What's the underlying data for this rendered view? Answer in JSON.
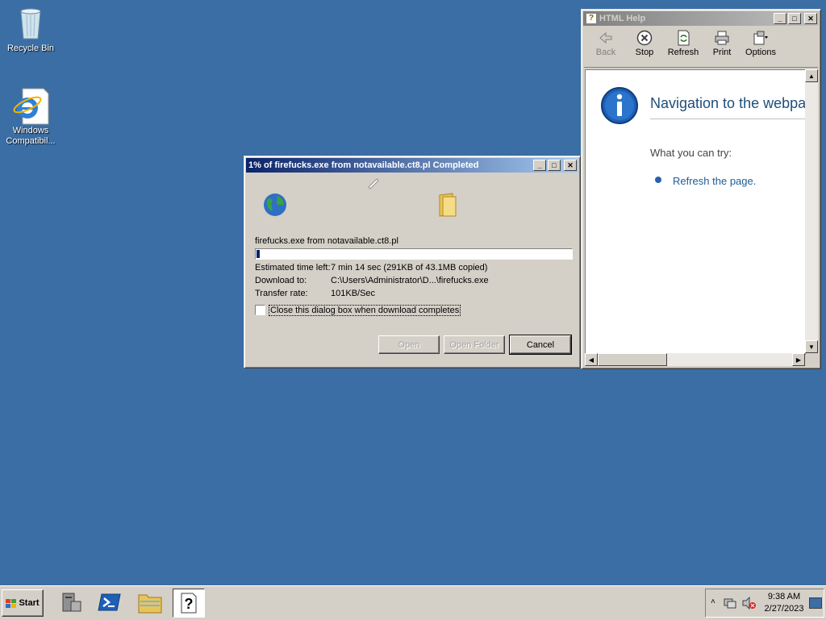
{
  "desktop": {
    "icons": [
      {
        "label": "Recycle Bin"
      },
      {
        "label": "Windows Compatibil..."
      }
    ]
  },
  "download": {
    "title": "1% of firefucks.exe from notavailable.ct8.pl Completed",
    "file_label": "firefucks.exe from notavailable.ct8.pl",
    "progress_fraction": 0.01,
    "est_label": "Estimated time left:",
    "est_value": "7 min 14 sec (291KB of 43.1MB copied)",
    "download_to_label": "Download to:",
    "download_to_value": "C:\\Users\\Administrator\\D...\\firefucks.exe",
    "rate_label": "Transfer rate:",
    "rate_value": "101KB/Sec",
    "close_checkbox_label": "Close this dialog box when download completes",
    "open_label": "Open",
    "open_folder_label": "Open Folder",
    "cancel_label": "Cancel"
  },
  "help": {
    "title": "HTML Help",
    "toolbar": [
      {
        "label": "Back",
        "icon": "back-arrow-icon",
        "enabled": false
      },
      {
        "label": "Stop",
        "icon": "stop-icon",
        "enabled": true
      },
      {
        "label": "Refresh",
        "icon": "refresh-icon",
        "enabled": true
      },
      {
        "label": "Print",
        "icon": "printer-icon",
        "enabled": true
      },
      {
        "label": "Options",
        "icon": "options-icon",
        "enabled": true
      }
    ],
    "heading": "Navigation to the webpa",
    "try_label": "What you can try:",
    "refresh_link": "Refresh the page."
  },
  "taskbar": {
    "start_label": "Start",
    "clock_time": "9:38 AM",
    "clock_date": "2/27/2023"
  },
  "colors": {
    "desktop": "#3a6ea5",
    "active_title": "#0a246a",
    "link_blue": "#1e5b94",
    "heading": "#1f4e79"
  }
}
